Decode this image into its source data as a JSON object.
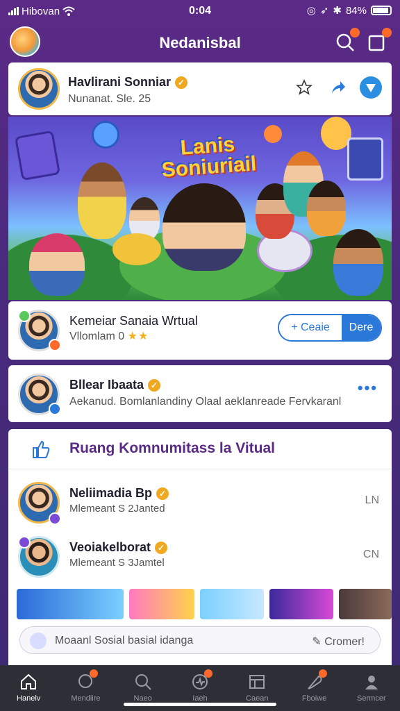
{
  "status_bar": {
    "carrier": "Hibovan",
    "time": "0:04",
    "battery": "84%"
  },
  "header": {
    "title": "Nedanisbal"
  },
  "profile_card": {
    "name": "Havlirani Sonniar",
    "subtitle": "Nunanat. Sle. 25"
  },
  "hero": {
    "title_line1": "Lanis",
    "title_line2": "Soniuriail"
  },
  "virtual_card": {
    "name": "Kemeiar Sanaia Wrtual",
    "subtitle": "Vllomlam 0",
    "stars": "★★",
    "follow_label": "+ Ceaie",
    "second_label": "Dere"
  },
  "post_card": {
    "name": "Bllear Ibaata",
    "text": "Aekanud. Bomlanlandiny Olaal aeklanreade Fervkaranl",
    "more": "•••"
  },
  "community": {
    "title": "Ruang Komnumitass la Vitual",
    "members": [
      {
        "name": "Neliimadia Bp",
        "subtitle": "Mlemeant S 2Janted",
        "side": "LN"
      },
      {
        "name": "Veoiakelborat",
        "subtitle": "Mlemeant S 3Jamtel",
        "side": "CN"
      }
    ]
  },
  "compose": {
    "placeholder": "Moaanl Sosial basial idanga",
    "action": "Cromer!"
  },
  "bottom_nav": {
    "items": [
      {
        "label": "Hanelv",
        "icon": "home-icon"
      },
      {
        "label": "Mendiire",
        "icon": "chat-icon"
      },
      {
        "label": "Naeo",
        "icon": "search-icon"
      },
      {
        "label": "Iaeh",
        "icon": "activity-icon"
      },
      {
        "label": "Caean",
        "icon": "store-icon"
      },
      {
        "label": "Fboiwe",
        "icon": "feather-icon"
      },
      {
        "label": "Sermcer",
        "icon": "profile-icon"
      }
    ]
  },
  "colors": {
    "accent": "#2a78d8",
    "brand": "#5b2a86",
    "badge": "#ff6a2a",
    "verified": "#f0a820"
  }
}
